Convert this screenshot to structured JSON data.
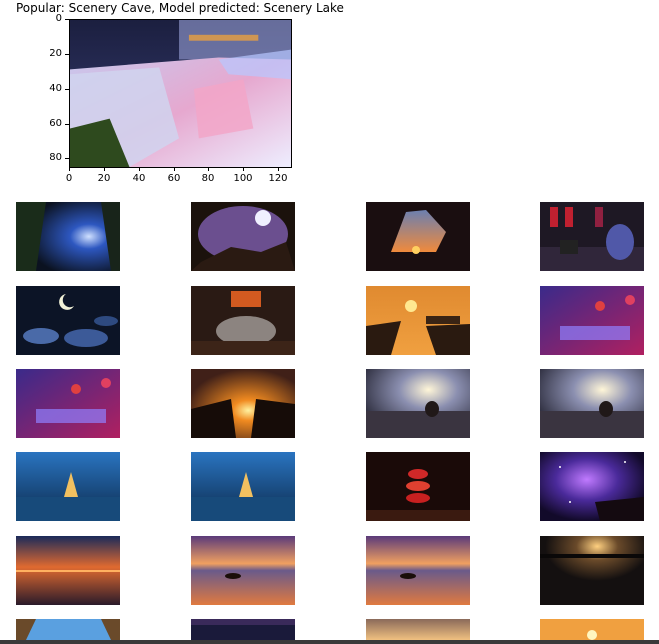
{
  "header": {
    "title": "Popular: Scenery Cave, Model predicted: Scenery Lake"
  },
  "main_plot": {
    "y_ticks": [
      "0",
      "20",
      "40",
      "60",
      "80"
    ],
    "x_ticks": [
      "0",
      "20",
      "40",
      "60",
      "80",
      "100",
      "120"
    ],
    "image_subject": "waterfall-at-night"
  },
  "grid": {
    "rows": [
      [
        "cave-light",
        "cave-moon",
        "cliff-sunset",
        "person-at-desk"
      ],
      [
        "moon-clouds",
        "cat-fireplace",
        "impossible-jump",
        "balloons-neon"
      ],
      [
        "balloons-neon",
        "cliff-sunburst",
        "meditation-lake",
        "meditation-lake"
      ],
      [
        "sailboat-blue",
        "sailboat-blue",
        "apple-spiral",
        "galaxy-unicorn"
      ],
      [
        "beach-sunset",
        "boat-reflection",
        "boat-reflection",
        "dark-lake-sunset"
      ],
      [
        "cave-sky",
        "night-sky",
        "sunset-glow",
        "desert-sunset"
      ]
    ]
  }
}
